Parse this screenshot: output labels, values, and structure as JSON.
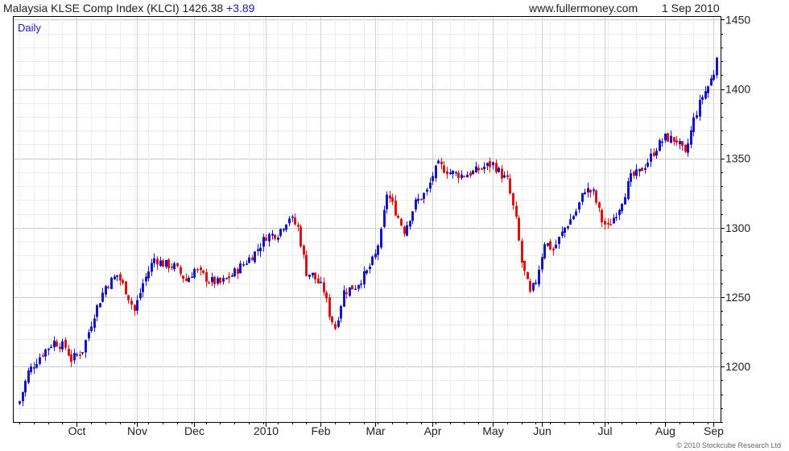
{
  "header": {
    "title": "Malaysia KLSE Comp Index (KLCI) 1426.38",
    "change": "+3.89",
    "website": "www.fullermoney.com",
    "date": "1 Sep 2010"
  },
  "panel_label": "Daily",
  "copyright": "© 2010 Stockcube Research Ltd",
  "colors": {
    "up": "#1414c8",
    "down": "#e01010",
    "grid": "#d9d9d9",
    "border": "#000000"
  },
  "chart_data": {
    "type": "candlestick",
    "period": "Daily",
    "ylim": [
      1160,
      1452
    ],
    "y_ticks": [
      1200,
      1250,
      1300,
      1350,
      1400,
      1450
    ],
    "x_ticks": [
      "Oct",
      "Nov",
      "Dec",
      "2010",
      "Feb",
      "Mar",
      "Apr",
      "May",
      "Jun",
      "Jul",
      "Aug",
      "Sep"
    ],
    "x_tick_session": [
      20,
      41,
      61,
      86,
      105,
      124,
      144,
      165,
      182,
      204,
      225,
      242
    ],
    "n_sessions": 244,
    "y_axis_side": "right",
    "grid": true,
    "anchors": [
      [
        0,
        1175
      ],
      [
        3,
        1196
      ],
      [
        8,
        1210
      ],
      [
        12,
        1218
      ],
      [
        16,
        1214
      ],
      [
        18,
        1205
      ],
      [
        22,
        1212
      ],
      [
        26,
        1238
      ],
      [
        30,
        1258
      ],
      [
        34,
        1266
      ],
      [
        37,
        1255
      ],
      [
        40,
        1240
      ],
      [
        43,
        1260
      ],
      [
        47,
        1278
      ],
      [
        50,
        1274
      ],
      [
        54,
        1272
      ],
      [
        58,
        1262
      ],
      [
        61,
        1270
      ],
      [
        66,
        1262
      ],
      [
        70,
        1260
      ],
      [
        74,
        1266
      ],
      [
        78,
        1274
      ],
      [
        82,
        1282
      ],
      [
        86,
        1294
      ],
      [
        90,
        1296
      ],
      [
        94,
        1308
      ],
      [
        97,
        1300
      ],
      [
        100,
        1268
      ],
      [
        102,
        1266
      ],
      [
        106,
        1255
      ],
      [
        108,
        1238
      ],
      [
        110,
        1228
      ],
      [
        113,
        1254
      ],
      [
        117,
        1258
      ],
      [
        121,
        1268
      ],
      [
        124,
        1280
      ],
      [
        126,
        1296
      ],
      [
        128,
        1325
      ],
      [
        131,
        1312
      ],
      [
        134,
        1298
      ],
      [
        138,
        1318
      ],
      [
        142,
        1326
      ],
      [
        144,
        1338
      ],
      [
        146,
        1345
      ],
      [
        150,
        1340
      ],
      [
        154,
        1338
      ],
      [
        158,
        1340
      ],
      [
        162,
        1344
      ],
      [
        165,
        1346
      ],
      [
        168,
        1338
      ],
      [
        170,
        1334
      ],
      [
        173,
        1305
      ],
      [
        175,
        1275
      ],
      [
        178,
        1252
      ],
      [
        180,
        1262
      ],
      [
        183,
        1290
      ],
      [
        186,
        1284
      ],
      [
        190,
        1300
      ],
      [
        194,
        1312
      ],
      [
        197,
        1328
      ],
      [
        200,
        1325
      ],
      [
        203,
        1305
      ],
      [
        205,
        1300
      ],
      [
        209,
        1315
      ],
      [
        213,
        1336
      ],
      [
        216,
        1340
      ],
      [
        219,
        1348
      ],
      [
        222,
        1358
      ],
      [
        225,
        1365
      ],
      [
        229,
        1363
      ],
      [
        232,
        1352
      ],
      [
        235,
        1378
      ],
      [
        238,
        1395
      ],
      [
        240,
        1402
      ],
      [
        242,
        1412
      ],
      [
        243,
        1426
      ]
    ]
  }
}
